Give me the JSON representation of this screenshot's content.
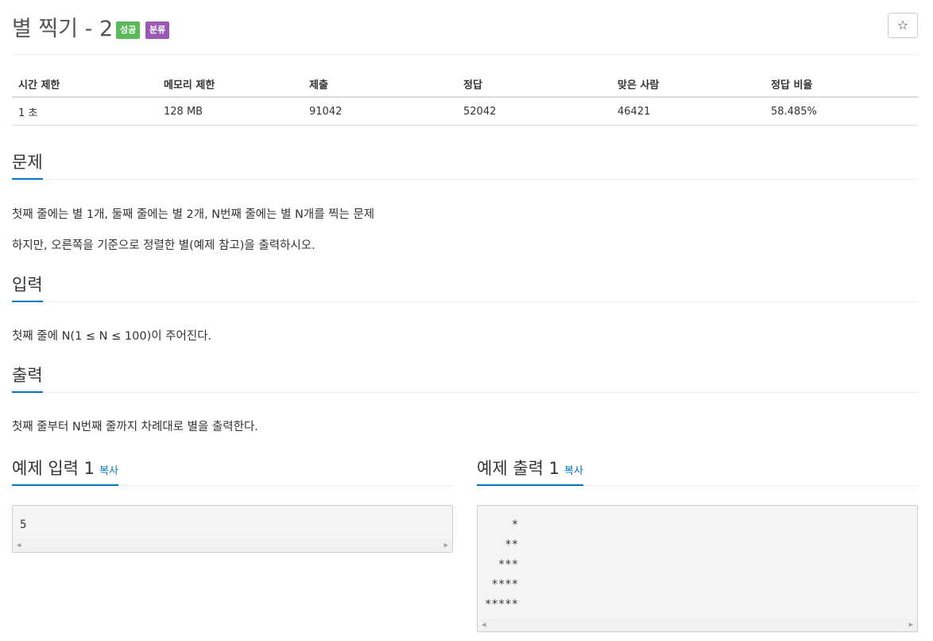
{
  "problem": {
    "title": "별 찍기 - 2",
    "badges": {
      "success": "성공",
      "category": "분류"
    },
    "star_icon": "☆"
  },
  "info": {
    "headers": [
      "시간 제한",
      "메모리 제한",
      "제출",
      "정답",
      "맞은 사람",
      "정답 비율"
    ],
    "values": [
      "1 초",
      "128 MB",
      "91042",
      "52042",
      "46421",
      "58.485%"
    ]
  },
  "sections": {
    "description": {
      "heading": "문제",
      "lines": [
        "첫째 줄에는 별 1개, 둘째 줄에는 별 2개, N번째 줄에는 별 N개를 찍는 문제",
        "하지만, 오른쪽을 기준으로 정렬한 별(예제 참고)을 출력하시오."
      ]
    },
    "input": {
      "heading": "입력",
      "text": "첫째 줄에 N(1 ≤ N ≤ 100)이 주어진다."
    },
    "output": {
      "heading": "출력",
      "text": "첫째 줄부터 N번째 줄까지 차례대로 별을 출력한다."
    }
  },
  "samples": {
    "input": {
      "heading": "예제 입력 1",
      "copy": "복사",
      "content": "5"
    },
    "output": {
      "heading": "예제 출력 1",
      "copy": "복사",
      "content": "    *\n   **\n  ***\n ****\n*****"
    }
  },
  "icons": {
    "scroll_left": "◀",
    "scroll_right": "▶"
  },
  "colors": {
    "accent": "#0076c0",
    "success": "#5cb85c",
    "category": "#9b59b6"
  }
}
